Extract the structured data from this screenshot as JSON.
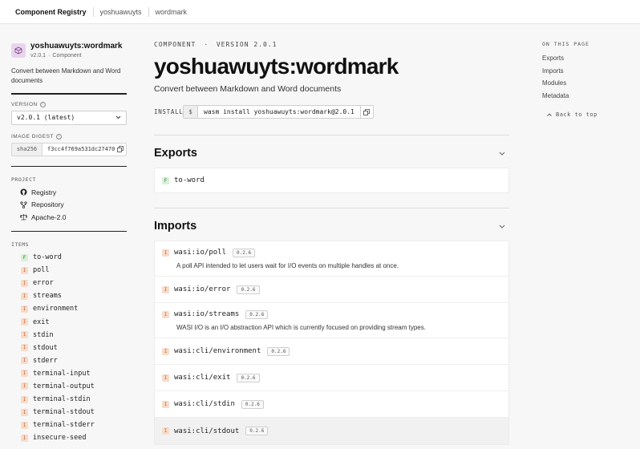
{
  "topbar": {
    "brand": "Component Registry",
    "crumbs": [
      "yoshuawuyts",
      "wordmark"
    ]
  },
  "package": {
    "icon": "package-icon",
    "name": "yoshuawuyts:wordmark",
    "version": "v2.0.1",
    "kind": "Component",
    "description": "Convert between Markdown and Word documents"
  },
  "version_select": {
    "label": "VERSION",
    "value": "v2.0.1 (latest)"
  },
  "digest": {
    "label": "IMAGE DIGEST",
    "algo": "sha256",
    "hash": "f3cc4f769a531dc27470"
  },
  "project": {
    "label": "PROJECT",
    "links": [
      {
        "label": "Registry",
        "icon": "github-icon"
      },
      {
        "label": "Repository",
        "icon": "repository-icon"
      },
      {
        "label": "Apache-2.0",
        "icon": "scale-icon"
      }
    ]
  },
  "items": {
    "label": "ITEMS",
    "list": [
      {
        "kind": "F",
        "name": "to-word"
      },
      {
        "kind": "I",
        "name": "poll"
      },
      {
        "kind": "I",
        "name": "error"
      },
      {
        "kind": "I",
        "name": "streams"
      },
      {
        "kind": "I",
        "name": "environment"
      },
      {
        "kind": "I",
        "name": "exit"
      },
      {
        "kind": "I",
        "name": "stdin"
      },
      {
        "kind": "I",
        "name": "stdout"
      },
      {
        "kind": "I",
        "name": "stderr"
      },
      {
        "kind": "I",
        "name": "terminal-input"
      },
      {
        "kind": "I",
        "name": "terminal-output"
      },
      {
        "kind": "I",
        "name": "terminal-stdin"
      },
      {
        "kind": "I",
        "name": "terminal-stdout"
      },
      {
        "kind": "I",
        "name": "terminal-stderr"
      },
      {
        "kind": "I",
        "name": "insecure-seed"
      }
    ]
  },
  "main": {
    "kicker_left": "COMPONENT",
    "kicker_sep": "·",
    "kicker_right": "VERSION 2.0.1",
    "title": "yoshuawuyts:wordmark",
    "subtitle": "Convert between Markdown and Word documents",
    "install_label": "INSTALL",
    "install_prompt": "$",
    "install_cmd": "wasm install yoshuawuyts:wordmark@2.0.1"
  },
  "exports": {
    "title": "Exports",
    "list": [
      {
        "kind": "F",
        "name": "to-word"
      }
    ]
  },
  "imports": {
    "title": "Imports",
    "list": [
      {
        "kind": "I",
        "name": "wasi:io/poll",
        "version": "0.2.6",
        "desc": "A poll API intended to let users wait for I/O events on multiple handles at once."
      },
      {
        "kind": "I",
        "name": "wasi:io/error",
        "version": "0.2.6",
        "desc": ""
      },
      {
        "kind": "I",
        "name": "wasi:io/streams",
        "version": "0.2.6",
        "desc": "WASI I/O is an I/O abstraction API which is currently focused on providing stream types."
      },
      {
        "kind": "I",
        "name": "wasi:cli/environment",
        "version": "0.2.6",
        "desc": ""
      },
      {
        "kind": "I",
        "name": "wasi:cli/exit",
        "version": "0.2.6",
        "desc": ""
      },
      {
        "kind": "I",
        "name": "wasi:cli/stdin",
        "version": "0.2.6",
        "desc": ""
      },
      {
        "kind": "I",
        "name": "wasi:cli/stdout",
        "version": "0.2.6",
        "desc": ""
      }
    ]
  },
  "toc": {
    "title": "ON THIS PAGE",
    "links": [
      "Exports",
      "Imports",
      "Modules",
      "Metadata"
    ],
    "back": "Back to top"
  },
  "colors": {
    "badge_func_bg": "#d9efd9",
    "badge_func_fg": "#2e7d32",
    "badge_iface_bg": "#f7dccb",
    "badge_iface_fg": "#c4622d",
    "package_icon_bg": "#e8d4ec"
  }
}
